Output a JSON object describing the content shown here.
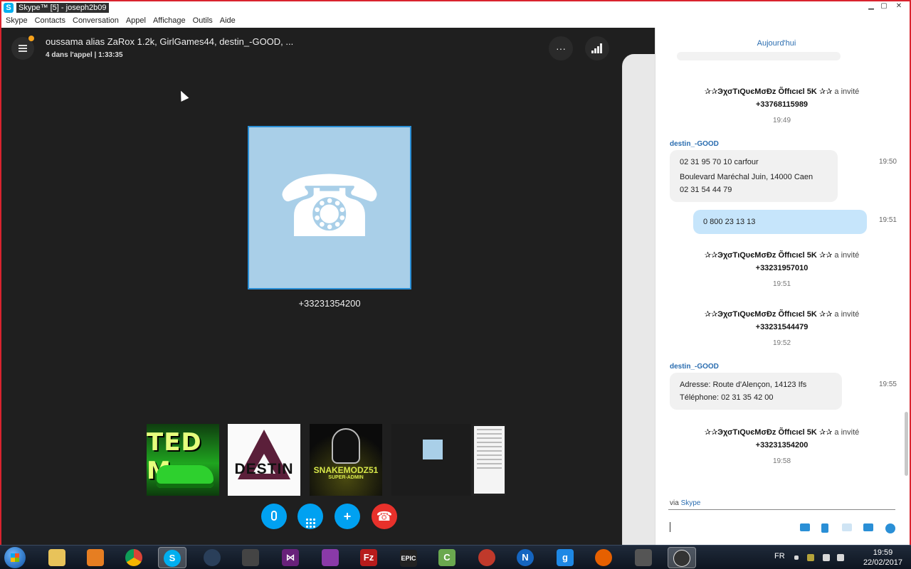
{
  "window": {
    "title": "Skype™ [5] - joseph2b09",
    "app_icon": "skype-icon",
    "controls": [
      "minimize",
      "maximize",
      "close"
    ]
  },
  "menu": [
    "Skype",
    "Contacts",
    "Conversation",
    "Appel",
    "Affichage",
    "Outils",
    "Aide"
  ],
  "call": {
    "title": "oussama alias ZaRox 1.2k, GirlGames44, destin_-GOOD, ...",
    "subtitle": "4 dans l'appel | 1:33:35",
    "more_glyph": "···",
    "participant_number": "+33231354200",
    "thumbnails": [
      {
        "label": "TED M",
        "kind": "game-thumbnail"
      },
      {
        "label": "DESTIN",
        "kind": "logo-thumbnail"
      },
      {
        "label": "SNAKEMODZ51",
        "sub": "SUPER-ADMIN",
        "kind": "logo-thumbnail"
      },
      {
        "label": "",
        "kind": "screen-share-thumbnail"
      }
    ],
    "controls": {
      "add_glyph": "+",
      "hangup_glyph": "☎"
    },
    "phone_glyph": "☎",
    "colors": {
      "background": "#1f1f1f",
      "tile": "#a9cfe8",
      "accent": "#00a1f1",
      "hangup": "#e8312b"
    }
  },
  "chat": {
    "date_header": "Aujourd'hui",
    "invites": [
      {
        "name": "✰✰ЭχσTιQυєMσÐz Õffιcιєl 5K ✰✰",
        "action": "a invité",
        "number": "+33768115989",
        "time": "19:49"
      },
      {
        "name": "✰✰ЭχσTιQυєMσÐz Õffιcιєl 5K ✰✰",
        "action": "a invité",
        "number": "+33231957010",
        "time": "19:51"
      },
      {
        "name": "✰✰ЭχσTιQυєMσÐz Õffιcιєl 5K ✰✰",
        "action": "a invité",
        "number": "+33231544479",
        "time": "19:52"
      },
      {
        "name": "✰✰ЭχσTιQυєMσÐz Õffιcιєl 5K ✰✰",
        "action": "a invité",
        "number": "+33231354200",
        "time": "19:58"
      }
    ],
    "messages": [
      {
        "sender": "destin_-GOOD",
        "lines": [
          "02 31 95 70 10 carfour",
          "Boulevard Maréchal Juin, 14000 Caen",
          "02 31 54 44 79"
        ],
        "time": "19:50"
      },
      {
        "sender": "",
        "lines": [
          "0 800 23 13 13"
        ],
        "time": "19:51",
        "mine": true
      },
      {
        "sender": "destin_-GOOD",
        "lines": [
          "Adresse: Route d'Alençon, 14123 Ifs",
          "Téléphone: 02 31 35 42 00"
        ],
        "time": "19:55"
      }
    ],
    "via_prefix": "via",
    "via_link": "Skype"
  },
  "taskbar": {
    "apps": [
      "windows-explorer",
      "media-player",
      "chrome",
      "skype",
      "steam",
      "unity",
      "visual-studio",
      "visual-studio-preview",
      "filezilla",
      "epic-games",
      "camtasia",
      "davinci",
      "n-app",
      "g-app",
      "firefox",
      "game-launcher",
      "obs"
    ],
    "labels": {
      "epic": "EPIC",
      "filezilla": "Fz",
      "camtasia": "C",
      "n": "N",
      "g": "g",
      "vs": "⋈"
    },
    "language": "FR",
    "time": "19:59",
    "date": "22/02/2017"
  }
}
